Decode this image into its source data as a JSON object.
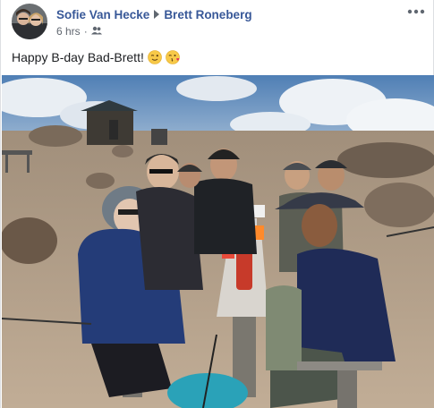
{
  "post": {
    "author": "Sofie Van Hecke",
    "recipient": "Brett Roneberg",
    "timestamp": "6 hrs",
    "separator": "·",
    "audience_icon": "friends-icon",
    "more_icon": "more-options-icon",
    "text": "Happy B-day Bad-Brett!",
    "emojis": [
      "winking-face-icon",
      "face-blowing-kiss-icon"
    ]
  },
  "colors": {
    "name_link": "#385898",
    "meta_text": "#616770",
    "body_text": "#1c1e21"
  }
}
